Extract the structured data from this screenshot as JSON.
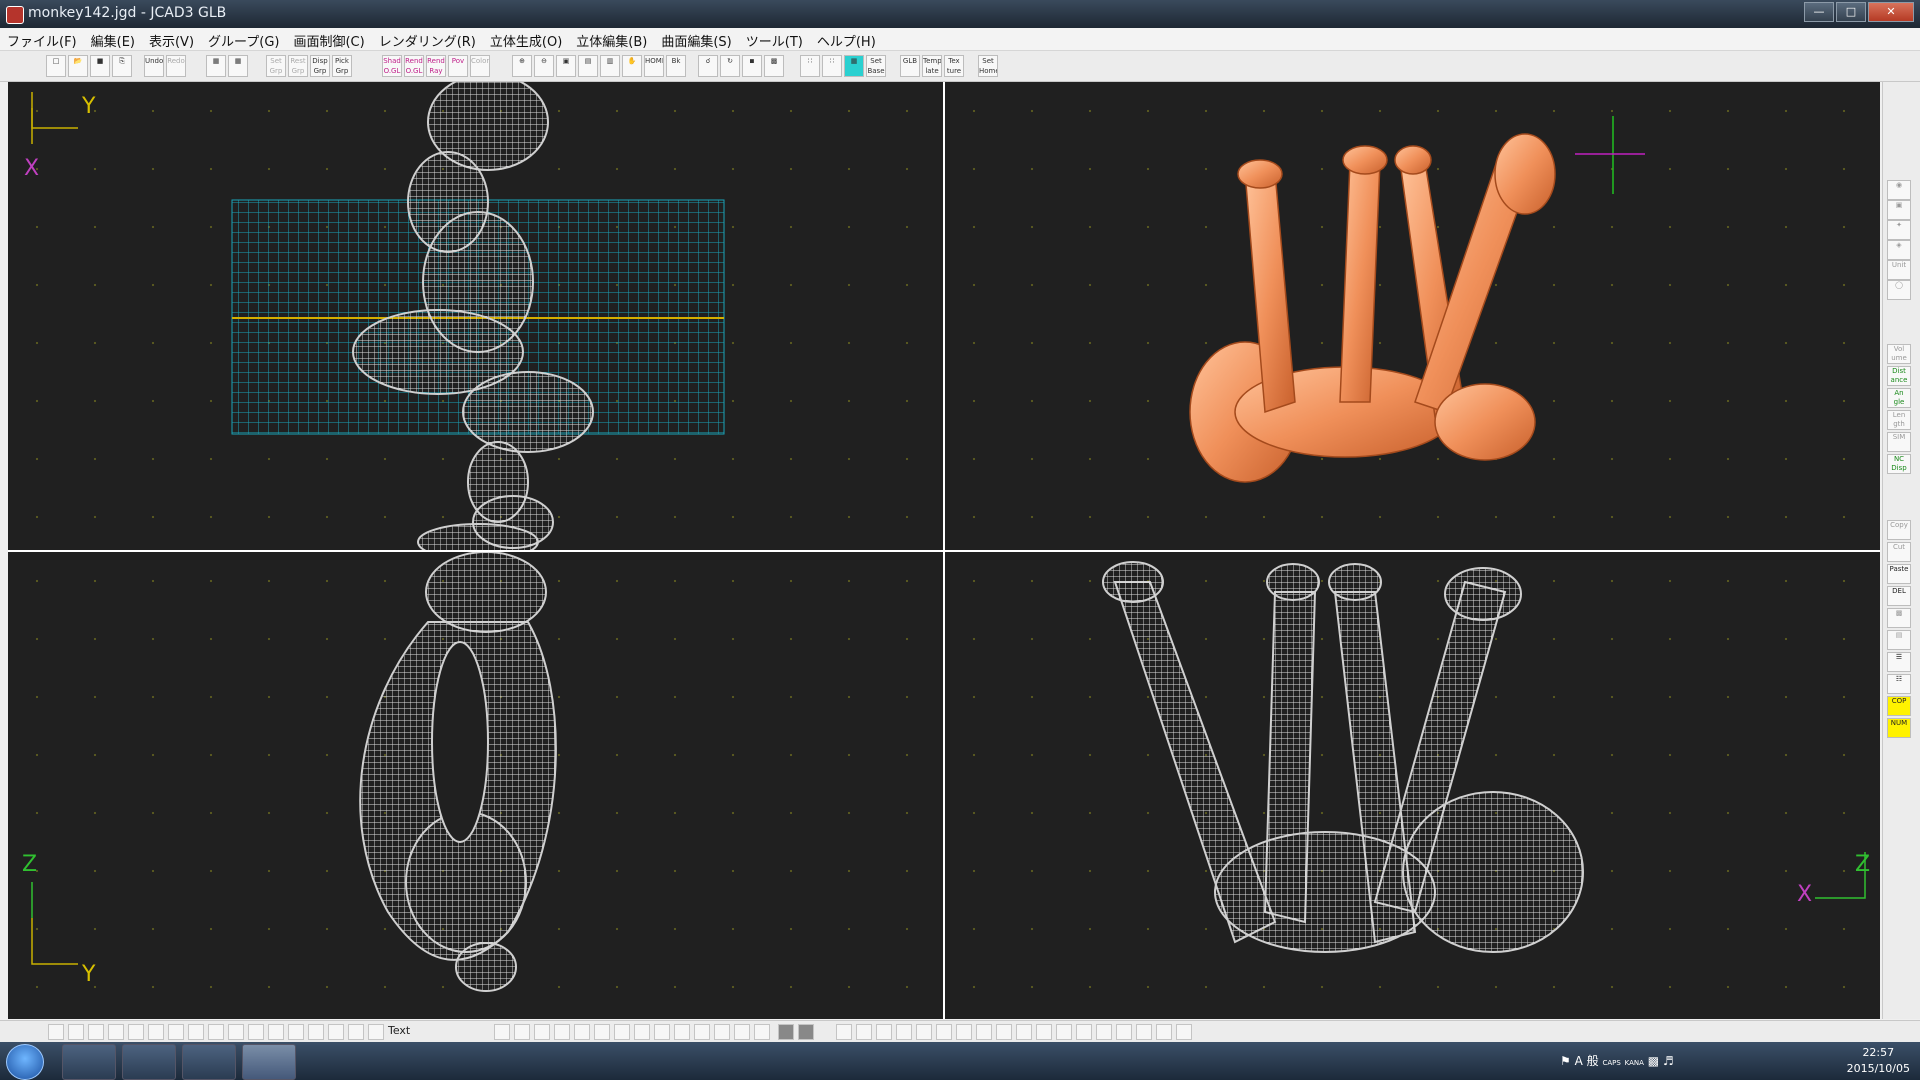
{
  "window": {
    "title": "monkey142.jgd - JCAD3 GLB"
  },
  "menu": [
    "ファイル(F)",
    "編集(E)",
    "表示(V)",
    "グループ(G)",
    "画面制御(C)",
    "レンダリング(R)",
    "立体生成(O)",
    "立体編集(B)",
    "曲面編集(S)",
    "ツール(T)",
    "ヘルプ(H)"
  ],
  "toolbar": {
    "undo": "Undo",
    "redo": "Redo",
    "set_grp": "Set Grp",
    "rest_grp": "Rest Grp",
    "disp_grp": "Disp Grp",
    "pick_grp": "Pick Grp",
    "shad": "Shad O.GL",
    "rend_ogl": "Rend O.GL",
    "rend_ray": "Rend Ray",
    "pov": "Pov",
    "color": "Color",
    "home": "HOME",
    "bk": "Bk",
    "set_base": "Set Base",
    "glb": "GLB",
    "template": "Temp late",
    "texture": "Tex ture",
    "set_home": "Set Home"
  },
  "viewports": {
    "top_left": {
      "axis1": "Y",
      "axis2": "X",
      "view": "wireframe"
    },
    "top_right": {
      "view": "rendered"
    },
    "bottom_left": {
      "axis1": "Z",
      "axis2": "Y",
      "view": "wireframe"
    },
    "bottom_right": {
      "axis1": "Z",
      "axis2": "X",
      "view": "wireframe"
    }
  },
  "right_palette": [
    "Vol ume",
    "Dist ance",
    "An gle",
    "Len gth",
    "SIM",
    "NC Disp",
    "Copy",
    "Cut",
    "Paste",
    "DEL",
    "COP",
    "NUM"
  ],
  "bottom_toolbar": {
    "text_label": "Text"
  },
  "taskbar": {
    "ime_a": "A",
    "ime_mode": "般",
    "caps": "CAPS",
    "kana": "KANA",
    "time": "22:57",
    "date": "2015/10/05"
  },
  "colors": {
    "viewport_bg": "#202020",
    "render_color": "#f0955e",
    "grid_cyan": "#1aa3b8",
    "wire_color": "#d6d6d6"
  }
}
